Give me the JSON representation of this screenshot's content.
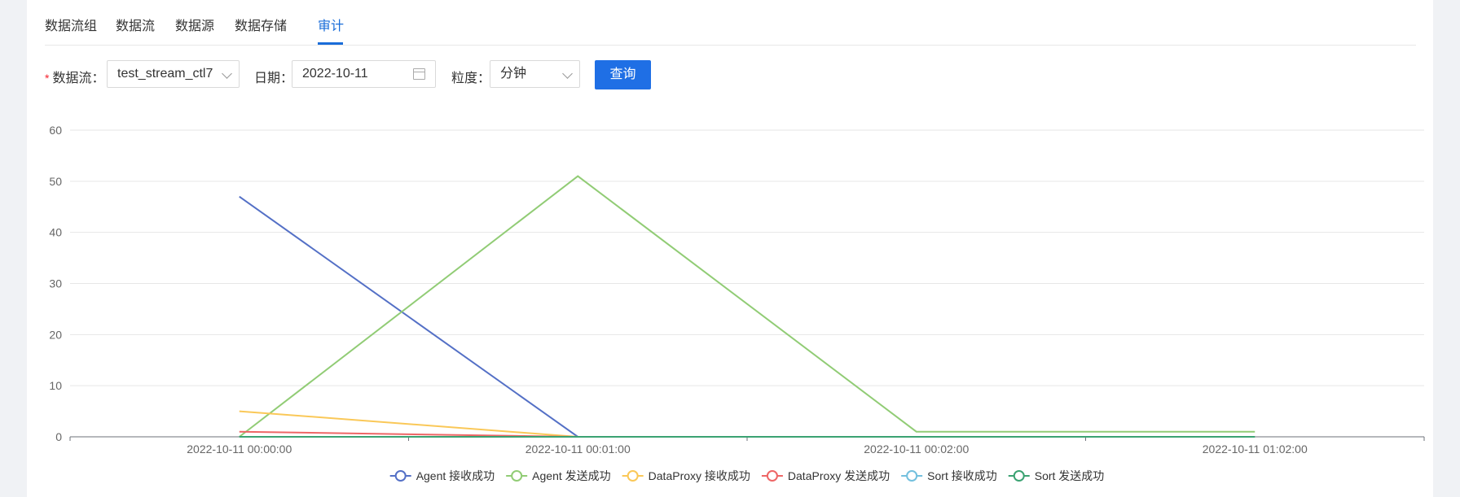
{
  "tabs": [
    {
      "label": "数据流组",
      "active": false
    },
    {
      "label": "数据流",
      "active": false
    },
    {
      "label": "数据源",
      "active": false
    },
    {
      "label": "数据存储",
      "active": false
    },
    {
      "label": "审计",
      "active": true
    }
  ],
  "form": {
    "stream_label": "数据流：",
    "stream_value": "test_stream_ctl7",
    "date_label": "日期：",
    "date_value": "2022-10-11",
    "granularity_label": "粒度：",
    "granularity_value": "分钟",
    "query_label": "查询"
  },
  "chart_data": {
    "type": "line",
    "categories": [
      "2022-10-11 00:00:00",
      "2022-10-11 00:01:00",
      "2022-10-11 00:02:00",
      "2022-10-11 01:02:00"
    ],
    "ylim": [
      0,
      60
    ],
    "yticks": [
      0,
      10,
      20,
      30,
      40,
      50,
      60
    ],
    "grid": true,
    "legend_position": "bottom",
    "series": [
      {
        "name": "Agent 接收成功",
        "color": "#5470c6",
        "values": [
          47,
          0,
          0,
          0
        ]
      },
      {
        "name": "Agent 发送成功",
        "color": "#91cc75",
        "values": [
          0,
          51,
          1,
          1
        ]
      },
      {
        "name": "DataProxy 接收成功",
        "color": "#fac858",
        "values": [
          5,
          0,
          0,
          0
        ]
      },
      {
        "name": "DataProxy 发送成功",
        "color": "#ee6666",
        "values": [
          1,
          0,
          0,
          0
        ]
      },
      {
        "name": "Sort 接收成功",
        "color": "#73c0de",
        "values": [
          0,
          0,
          0,
          0
        ]
      },
      {
        "name": "Sort 发送成功",
        "color": "#3ba272",
        "values": [
          0,
          0,
          0,
          0
        ]
      }
    ]
  }
}
